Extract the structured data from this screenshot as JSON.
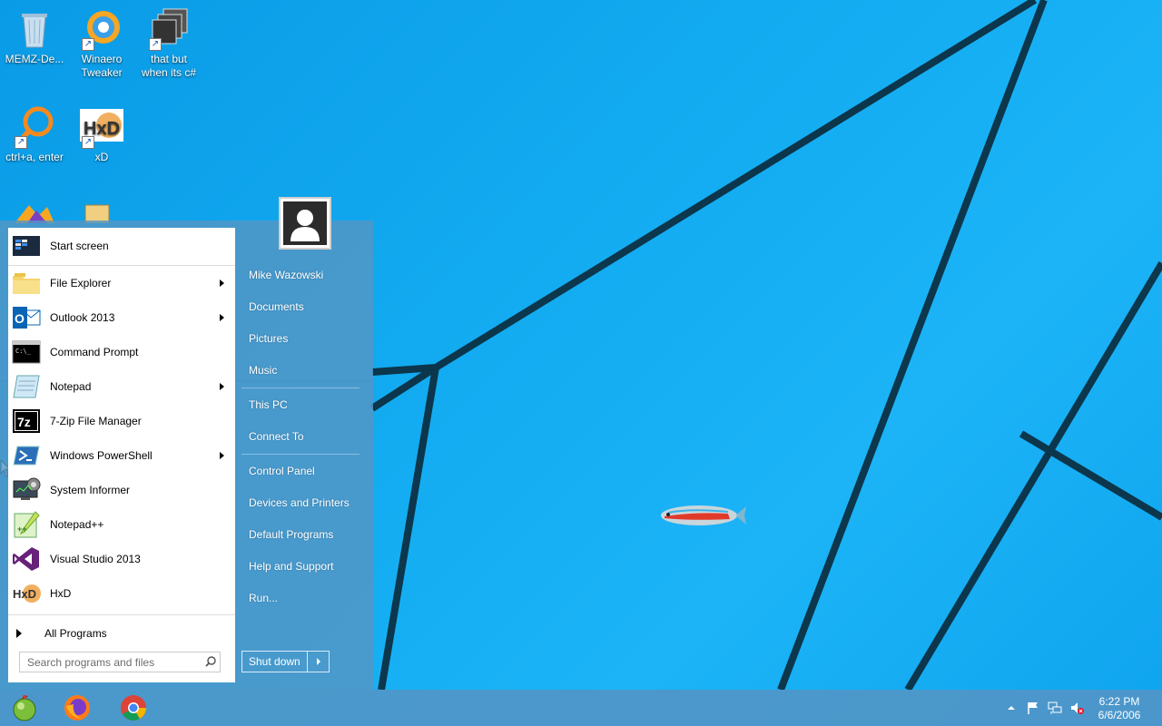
{
  "desktop": {
    "icons": [
      {
        "label": "MEMZ-De..."
      },
      {
        "label": "Winaero Tweaker"
      },
      {
        "label": "that but when its c#"
      },
      {
        "label": "ctrl+a, enter"
      },
      {
        "label": "xD"
      }
    ]
  },
  "start_menu": {
    "programs": [
      {
        "label": "Start screen"
      },
      {
        "label": "File Explorer"
      },
      {
        "label": "Outlook 2013"
      },
      {
        "label": "Command Prompt"
      },
      {
        "label": "Notepad"
      },
      {
        "label": "7-Zip File Manager"
      },
      {
        "label": "Windows PowerShell"
      },
      {
        "label": "System Informer"
      },
      {
        "label": "Notepad++"
      },
      {
        "label": "Visual Studio 2013"
      },
      {
        "label": "HxD"
      }
    ],
    "all_programs_label": "All Programs",
    "search_placeholder": "Search programs and files",
    "right_links": [
      {
        "label": "Mike Wazowski"
      },
      {
        "label": "Documents"
      },
      {
        "label": "Pictures"
      },
      {
        "label": "Music"
      },
      {
        "label": "This PC"
      },
      {
        "label": "Connect To"
      },
      {
        "label": "Control Panel"
      },
      {
        "label": "Devices and Printers"
      },
      {
        "label": "Default Programs"
      },
      {
        "label": "Help and Support"
      },
      {
        "label": "Run..."
      }
    ],
    "shutdown_label": "Shut down"
  },
  "taskbar": {
    "clock_time": "6:22 PM",
    "clock_date": "6/6/2006"
  },
  "colors": {
    "wallpaper": "#12aaf0",
    "menu_overlay": "#5496c4",
    "taskbar": "#5096c8"
  }
}
